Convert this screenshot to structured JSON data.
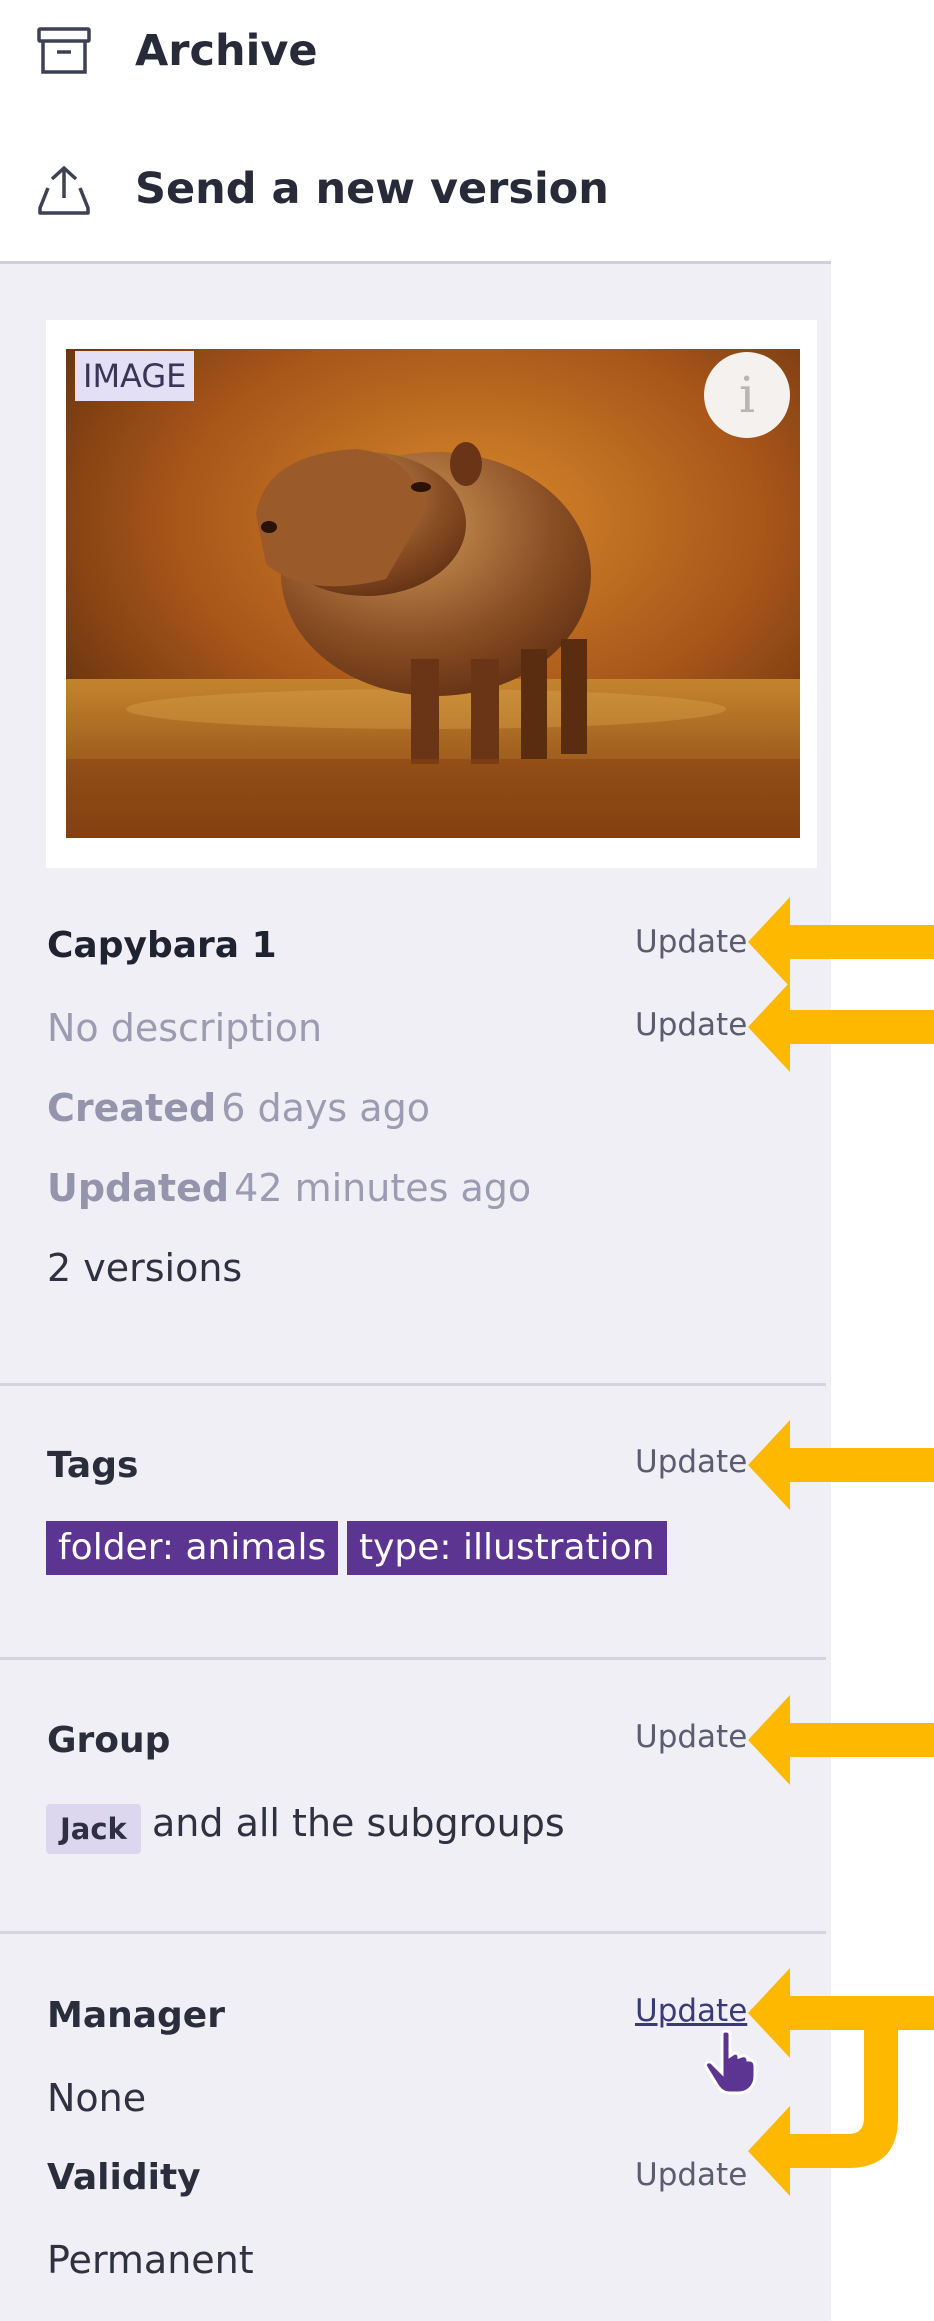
{
  "actions": {
    "archive_label": "Archive",
    "send_version_label": "Send a new version"
  },
  "asset": {
    "type_badge": "IMAGE",
    "info_label": "i",
    "title": "Capybara 1",
    "description": "No description",
    "created_label": "Created",
    "created_value": "6 days ago",
    "updated_label": "Updated",
    "updated_value": "42 minutes ago",
    "versions": "2 versions"
  },
  "update_label": "Update",
  "tags": {
    "heading": "Tags",
    "items": [
      "folder: animals",
      "type: illustration"
    ]
  },
  "group": {
    "heading": "Group",
    "chip": "Jack",
    "suffix": "and all the subgroups"
  },
  "manager": {
    "heading": "Manager",
    "value": "None"
  },
  "validity": {
    "heading": "Validity",
    "value": "Permanent"
  },
  "colors": {
    "sidebar_bg": "#efeff5",
    "tag_chip": "#5b3591",
    "group_chip": "#ddd6ef",
    "annotation_arrow": "#ffb800"
  }
}
